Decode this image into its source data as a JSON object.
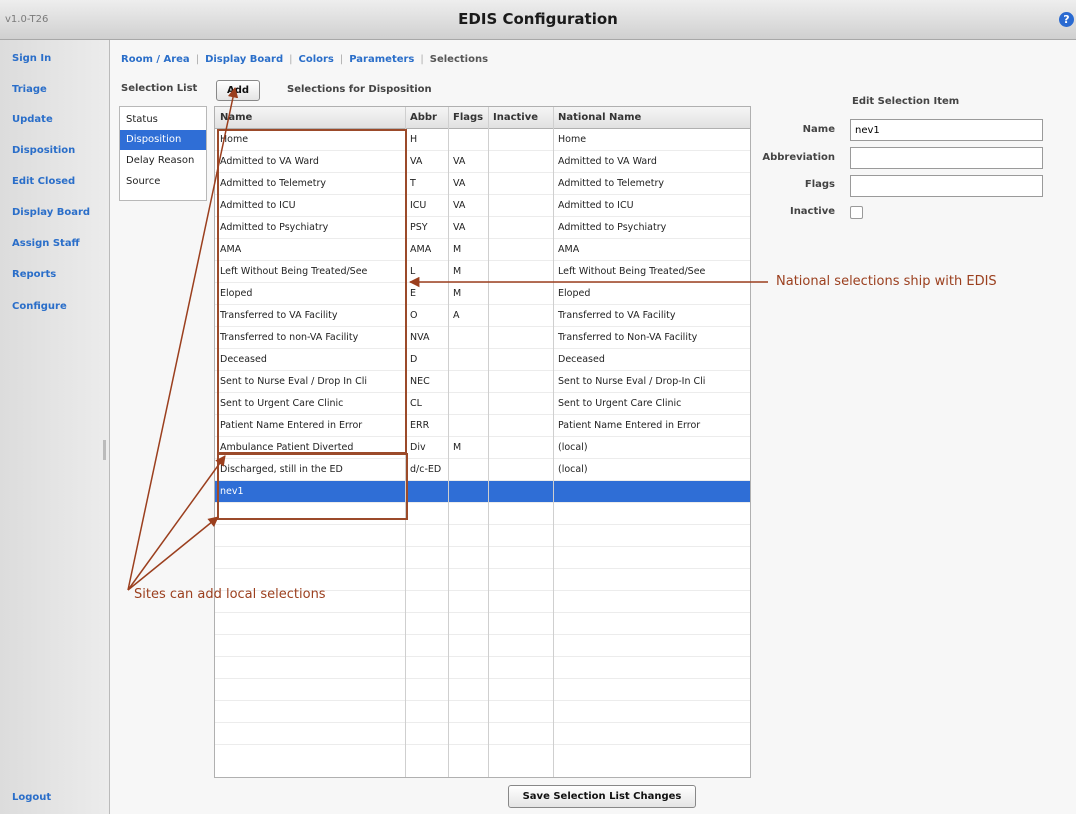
{
  "app": {
    "version": "v1.0-T26",
    "title": "EDIS Configuration",
    "help_icon": "?"
  },
  "sidebar": {
    "items": [
      {
        "label": "Sign In"
      },
      {
        "label": "Triage"
      },
      {
        "label": "Update"
      },
      {
        "label": "Disposition"
      },
      {
        "label": "Edit Closed"
      },
      {
        "label": "Display Board"
      },
      {
        "label": "Assign Staff"
      },
      {
        "label": "Reports"
      },
      {
        "label": "Configure"
      }
    ],
    "logout": "Logout"
  },
  "tabs": [
    "Room / Area",
    "Display Board",
    "Colors",
    "Parameters",
    "Selections"
  ],
  "selection_list": {
    "label": "Selection List",
    "add_button": "Add",
    "selections_for": "Selections for Disposition",
    "items": [
      "Status",
      "Disposition",
      "Delay Reason",
      "Source"
    ],
    "selected_index": 1
  },
  "grid": {
    "headers": {
      "name": "Name",
      "abbr": "Abbr",
      "flags": "Flags",
      "inactive": "Inactive",
      "national": "National Name"
    },
    "rows": [
      {
        "name": "Home",
        "abbr": "H",
        "flags": "",
        "inactive": "",
        "national": "Home"
      },
      {
        "name": "Admitted to VA Ward",
        "abbr": "VA",
        "flags": "VA",
        "inactive": "",
        "national": "Admitted to VA Ward"
      },
      {
        "name": "Admitted to Telemetry",
        "abbr": "T",
        "flags": "VA",
        "inactive": "",
        "national": "Admitted to Telemetry"
      },
      {
        "name": "Admitted to ICU",
        "abbr": "ICU",
        "flags": "VA",
        "inactive": "",
        "national": "Admitted to ICU"
      },
      {
        "name": "Admitted to Psychiatry",
        "abbr": "PSY",
        "flags": "VA",
        "inactive": "",
        "national": "Admitted to Psychiatry"
      },
      {
        "name": "AMA",
        "abbr": "AMA",
        "flags": "M",
        "inactive": "",
        "national": "AMA"
      },
      {
        "name": "Left Without Being Treated/See",
        "abbr": "L",
        "flags": "M",
        "inactive": "",
        "national": "Left Without Being Treated/See"
      },
      {
        "name": "Eloped",
        "abbr": "E",
        "flags": "M",
        "inactive": "",
        "national": "Eloped"
      },
      {
        "name": "Transferred to VA Facility",
        "abbr": "O",
        "flags": "A",
        "inactive": "",
        "national": "Transferred to VA Facility"
      },
      {
        "name": "Transferred to non-VA Facility",
        "abbr": "NVA",
        "flags": "",
        "inactive": "",
        "national": "Transferred to Non-VA Facility"
      },
      {
        "name": "Deceased",
        "abbr": "D",
        "flags": "",
        "inactive": "",
        "national": "Deceased"
      },
      {
        "name": "Sent to Nurse Eval / Drop In Cli",
        "abbr": "NEC",
        "flags": "",
        "inactive": "",
        "national": "Sent to Nurse Eval / Drop-In Cli"
      },
      {
        "name": "Sent to Urgent Care Clinic",
        "abbr": "CL",
        "flags": "",
        "inactive": "",
        "national": "Sent to Urgent Care Clinic"
      },
      {
        "name": "Patient Name Entered in Error",
        "abbr": "ERR",
        "flags": "",
        "inactive": "",
        "national": "Patient Name Entered in Error"
      },
      {
        "name": "Ambulance Patient Diverted",
        "abbr": "Div",
        "flags": "M",
        "inactive": "",
        "national": "(local)"
      },
      {
        "name": "Discharged, still in the ED",
        "abbr": "d/c-ED",
        "flags": "",
        "inactive": "",
        "national": "(local)"
      },
      {
        "name": "nev1",
        "abbr": "",
        "flags": "",
        "inactive": "",
        "national": ""
      }
    ],
    "selected_row": 16,
    "blank_rows": 11
  },
  "edit_item": {
    "title": "Edit Selection Item",
    "name_label": "Name",
    "name_value": "nev1",
    "abbr_label": "Abbreviation",
    "abbr_value": "",
    "flags_label": "Flags",
    "flags_value": "",
    "inactive_label": "Inactive",
    "inactive_checked": false
  },
  "save_button": "Save Selection List Changes",
  "annotations": {
    "national": "National selections ship with EDIS",
    "local": "Sites can add local selections"
  },
  "colors": {
    "accent": "#2f6ed6",
    "nav_link": "#2a6ec9",
    "annotation": "#9b3f1e"
  }
}
